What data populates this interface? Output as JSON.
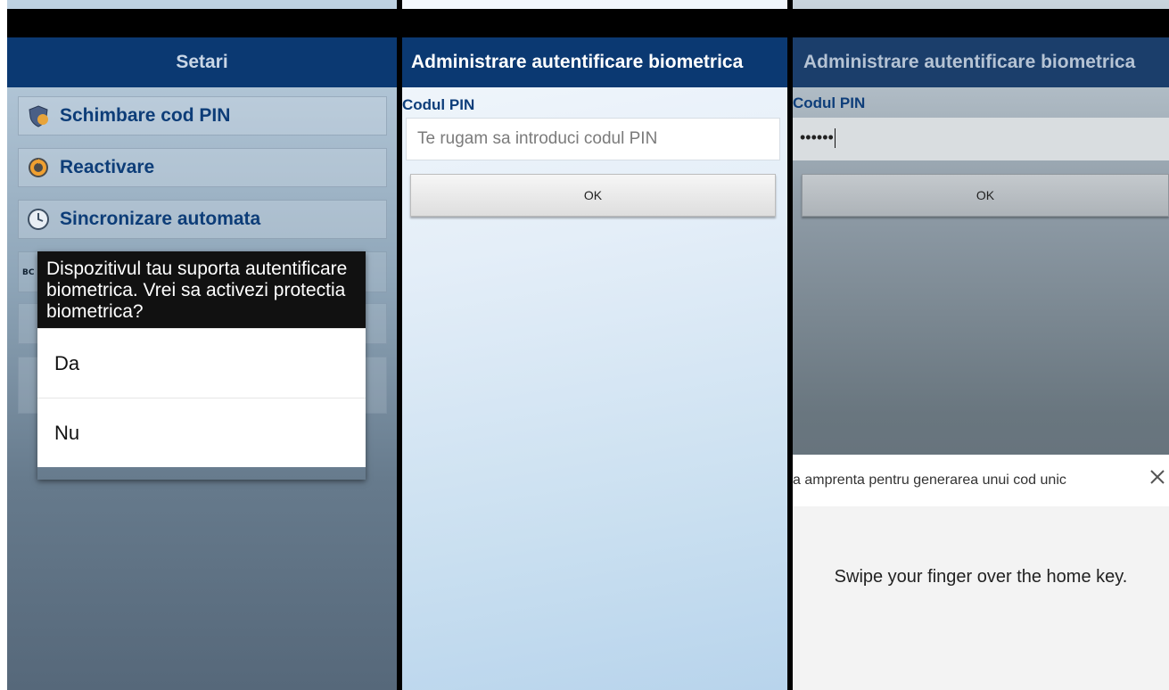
{
  "settings_screen": {
    "title": "Setari",
    "menu": [
      {
        "label": "Schimbare cod PIN",
        "icon": "shield-icon"
      },
      {
        "label": "Reactivare",
        "icon": "refresh-icon"
      },
      {
        "label": "Sincronizare automata",
        "icon": "clock-icon"
      }
    ],
    "dialog": {
      "message": "Dispozitivul tau suporta autentificare biometrica. Vrei sa activezi protectia biometrica?",
      "options": [
        "Da",
        "Nu"
      ]
    }
  },
  "pin_screen": {
    "title": "Administrare autentificare biometrica",
    "pin_label": "Codul PIN",
    "pin_placeholder": "Te rugam sa introduci codul PIN",
    "ok_label": "OK"
  },
  "fingerprint_screen": {
    "title": "Administrare autentificare biometrica",
    "pin_label": "Codul PIN",
    "pin_value": "••••••",
    "ok_label": "OK",
    "sheet_title": "a amprenta pentru generarea unui cod unic",
    "sheet_message": "Swipe your finger over the home key.",
    "close_icon": "close-icon"
  },
  "colors": {
    "title_bar": "#0b3972",
    "menu_text": "#0d3d78"
  }
}
